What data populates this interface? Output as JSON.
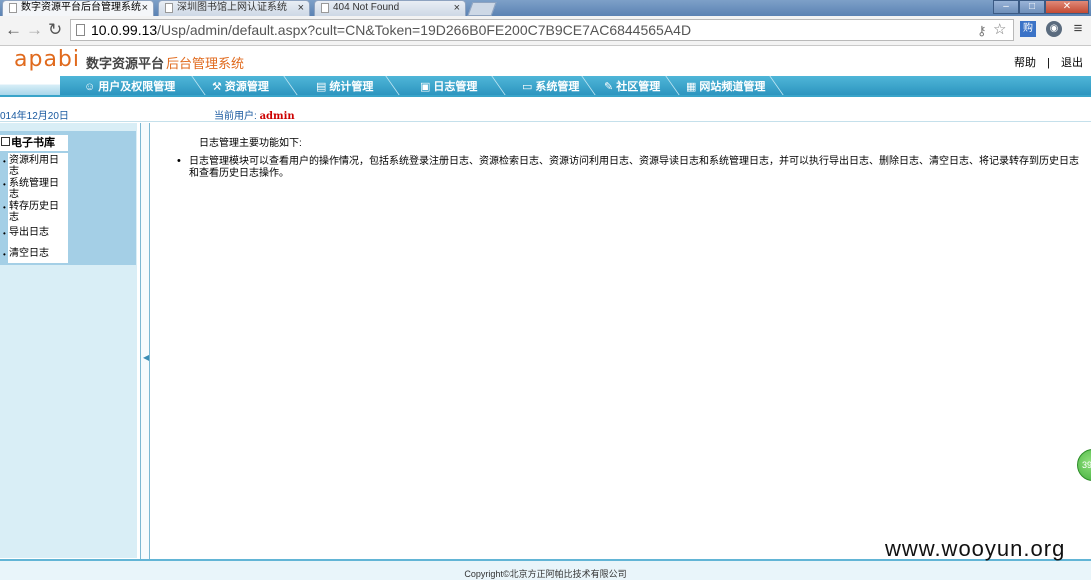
{
  "browser": {
    "tabs": [
      {
        "title": "数字资源平台后台管理系统",
        "active": true
      },
      {
        "title": "深圳图书馆上网认证系统",
        "active": false
      },
      {
        "title": "404 Not Found",
        "active": false
      }
    ],
    "url_host": "10.0.99.13",
    "url_path": "/Usp/admin/default.aspx?cult=CN&Token=19D266B0FE200C7B9CE7AC6844565A4D",
    "ext_badge": "购"
  },
  "header": {
    "logo": "apabi",
    "logo_sub": "数字资源平台",
    "system_name": "后台管理系统",
    "help": "帮助",
    "divider": "|",
    "logout": "退出"
  },
  "menu": [
    {
      "label": "用户及权限管理",
      "icon": "users-icon"
    },
    {
      "label": "资源管理",
      "icon": "tools-icon"
    },
    {
      "label": "统计管理",
      "icon": "chart-icon"
    },
    {
      "label": "日志管理",
      "icon": "log-icon"
    },
    {
      "label": "系统管理",
      "icon": "monitor-icon"
    },
    {
      "label": "社区管理",
      "icon": "community-icon"
    },
    {
      "label": "网站频道管理",
      "icon": "grid-icon"
    }
  ],
  "info": {
    "date": "014年12月20日",
    "current_user_label": "当前用户:",
    "current_user": "admin"
  },
  "sidebar": {
    "title": "电子书库",
    "items": [
      {
        "label": "资源利用日志"
      },
      {
        "label": "系统管理日志"
      },
      {
        "label": "转存历史日志"
      },
      {
        "label": "导出日志"
      },
      {
        "label": "清空日志"
      }
    ]
  },
  "content": {
    "intro": "日志管理主要功能如下:",
    "description": "日志管理模块可以查看用户的操作情况，包括系统登录注册日志、资源检索日志、资源访问利用日志、资源导读日志和系统管理日志，并可以执行导出日志、删除日志、清空日志、将记录转存到历史日志和查看历史日志操作。"
  },
  "footer": {
    "copyright": "Copyright©北京方正阿帕比技术有限公司"
  },
  "watermark": "www.wooyun.org",
  "float_button": "39"
}
